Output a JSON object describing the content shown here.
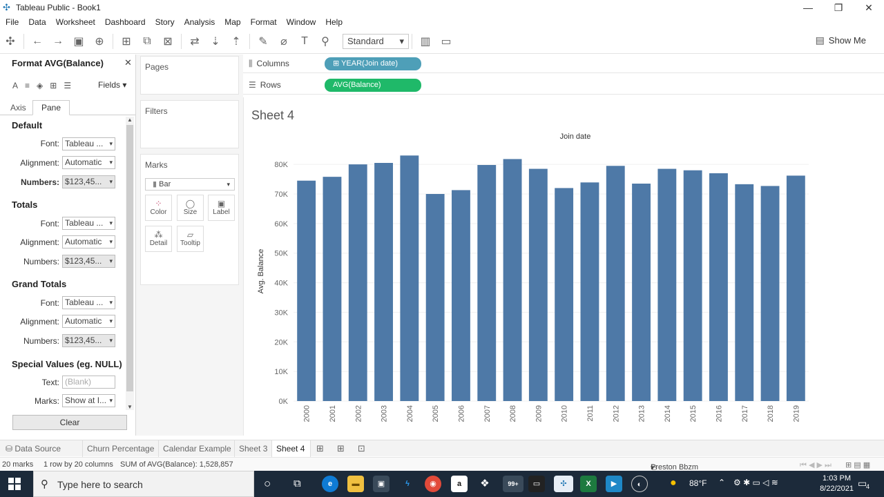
{
  "window": {
    "title": "Tableau Public - Book1"
  },
  "menu": [
    "File",
    "Data",
    "Worksheet",
    "Dashboard",
    "Story",
    "Analysis",
    "Map",
    "Format",
    "Window",
    "Help"
  ],
  "toolbar": {
    "fit_mode": "Standard",
    "show_me": "Show Me"
  },
  "format_panel": {
    "title": "Format AVG(Balance)",
    "fields_label": "Fields",
    "tabs": [
      "Axis",
      "Pane"
    ],
    "sections": [
      {
        "heading": "Default",
        "font_label": "Font:",
        "font": "Tableau ...",
        "alignment_label": "Alignment:",
        "alignment": "Automatic",
        "numbers_label": "Numbers:",
        "numbers": "$123,45..."
      },
      {
        "heading": "Totals",
        "font_label": "Font:",
        "font": "Tableau ...",
        "alignment_label": "Alignment:",
        "alignment": "Automatic",
        "numbers_label": "Numbers:",
        "numbers": "$123,45..."
      },
      {
        "heading": "Grand Totals",
        "font_label": "Font:",
        "font": "Tableau ...",
        "alignment_label": "Alignment:",
        "alignment": "Automatic",
        "numbers_label": "Numbers:",
        "numbers": "$123,45..."
      }
    ],
    "special": {
      "heading": "Special Values (eg. NULL)",
      "text_label": "Text:",
      "text_placeholder": "(Blank)",
      "marks_label": "Marks:",
      "marks": "Show at I..."
    },
    "clear": "Clear"
  },
  "cards": {
    "pages": "Pages",
    "filters": "Filters",
    "marks": "Marks",
    "mark_type": "Bar",
    "buttons": [
      "Color",
      "Size",
      "Label",
      "Detail",
      "Tooltip"
    ]
  },
  "shelves": {
    "columns_label": "Columns",
    "columns_pill": "YEAR(Join date)",
    "rows_label": "Rows",
    "rows_pill": "AVG(Balance)"
  },
  "sheet": {
    "title": "Sheet 4"
  },
  "chart_data": {
    "type": "bar",
    "title": "Join date",
    "xlabel": "",
    "ylabel": "Avg. Balance",
    "categories": [
      "2000",
      "2001",
      "2002",
      "2003",
      "2004",
      "2005",
      "2006",
      "2007",
      "2008",
      "2009",
      "2010",
      "2011",
      "2012",
      "2013",
      "2014",
      "2015",
      "2016",
      "2017",
      "2018",
      "2019"
    ],
    "values": [
      74500,
      75800,
      80000,
      80500,
      83000,
      70000,
      71300,
      79800,
      81800,
      78500,
      72000,
      73900,
      79500,
      73500,
      78500,
      78000,
      77000,
      73300,
      72700,
      76200
    ],
    "yticks": [
      "0K",
      "10K",
      "20K",
      "30K",
      "40K",
      "50K",
      "60K",
      "70K",
      "80K"
    ],
    "ylim": [
      0,
      84000
    ],
    "bar_color": "#4e79a7",
    "grid": true
  },
  "sheet_tabs": [
    "Data Source",
    "Churn Percentage",
    "Calendar Example",
    "Sheet 3",
    "Sheet 4"
  ],
  "status": {
    "marks": "20 marks",
    "dims": "1 row by 20 columns",
    "sum": "SUM of AVG(Balance): 1,528,857",
    "user": "Preston Bbzm"
  },
  "taskbar": {
    "search_placeholder": "Type here to search",
    "badge": "99+",
    "temp": "88°F",
    "time": "1:03 PM",
    "date": "8/22/2021",
    "notif": "4"
  }
}
